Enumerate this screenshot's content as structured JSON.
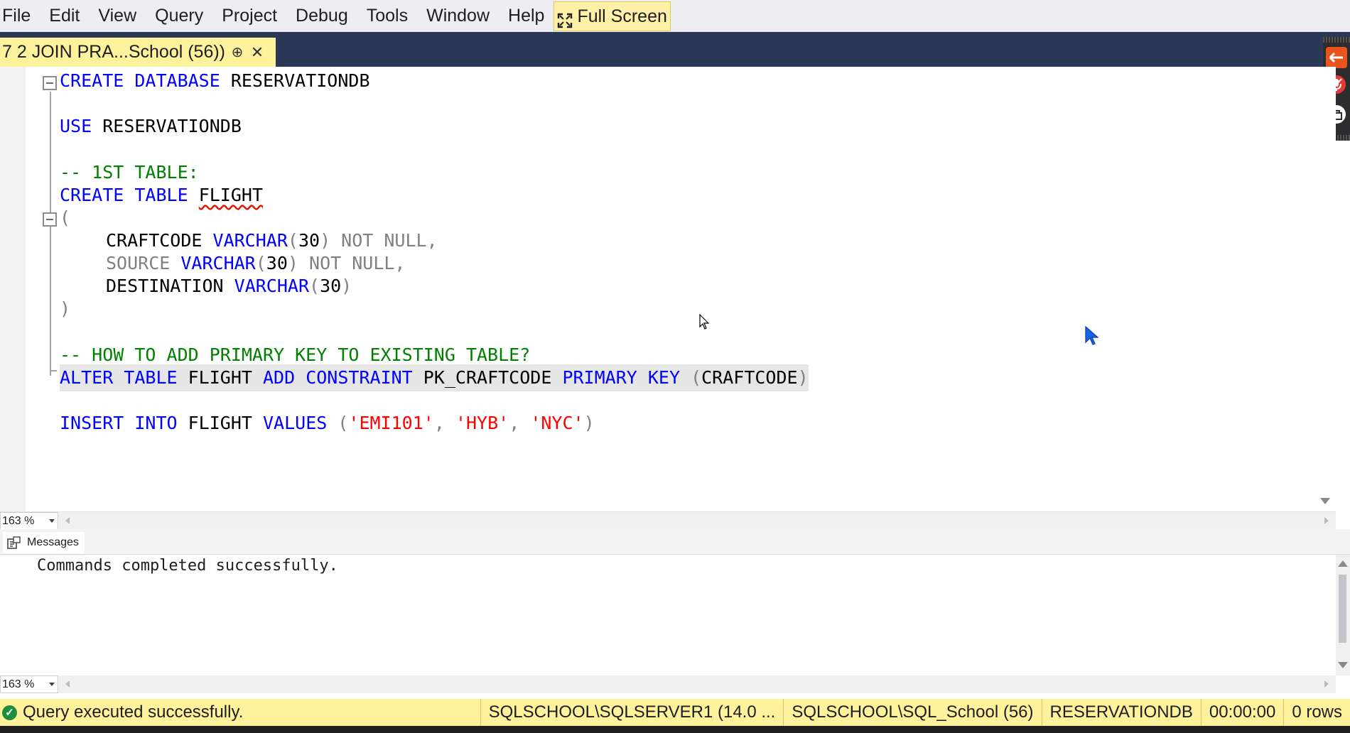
{
  "menu": {
    "items": [
      "File",
      "Edit",
      "View",
      "Query",
      "Project",
      "Debug",
      "Tools",
      "Window",
      "Help"
    ],
    "fullscreen_label": "Full Screen"
  },
  "tab": {
    "title": "7 2 JOIN PRA...School (56))",
    "pin_glyph": "⊕",
    "close_glyph": "✕"
  },
  "editor": {
    "lines": {
      "l1": {
        "kw": "CREATE DATABASE",
        "rest": " RESERVATIONDB"
      },
      "l2": {
        "kw": "USE",
        "rest": " RESERVATIONDB"
      },
      "l3": {
        "comment": "-- 1ST TABLE:"
      },
      "l4": {
        "kw": "CREATE TABLE",
        "name": "FLIGHT"
      },
      "l5": {
        "paren": "("
      },
      "l6": {
        "col": "CRAFTCODE",
        "type": "VARCHAR",
        "open": "(",
        "num": "30",
        "close": ")",
        "tail": " NOT NULL,"
      },
      "l7": {
        "col": "SOURCE",
        "type": "VARCHAR",
        "open": "(",
        "num": "30",
        "close": ")",
        "tail": " NOT NULL,"
      },
      "l8": {
        "col": "DESTINATION",
        "type": "VARCHAR",
        "open": "(",
        "num": "30",
        "close": ")"
      },
      "l9": {
        "paren": ")"
      },
      "l10": {
        "comment": "-- HOW TO ADD PRIMARY KEY TO EXISTING TABLE?"
      },
      "l11": {
        "kw1": "ALTER TABLE",
        "name1": " FLIGHT ",
        "kw2": "ADD CONSTRAINT",
        "name2": " PK_CRAFTCODE ",
        "kw3": "PRIMARY KEY",
        "open": " (",
        "col": "CRAFTCODE",
        "close": ")"
      },
      "l12": {
        "kw": "INSERT INTO",
        "name": " FLIGHT ",
        "kw2": "VALUES",
        "open": " (",
        "v1": "'EMI101'",
        "sep1": ", ",
        "v2": "'HYB'",
        "sep2": ", ",
        "v3": "'NYC'",
        "close": ")"
      }
    },
    "zoom": "163 %"
  },
  "messages": {
    "tab_label": "Messages",
    "text": "Commands completed successfully.",
    "zoom": "163 %"
  },
  "status": {
    "query_status": "Query executed successfully.",
    "server": "SQLSCHOOL\\SQLSERVER1 (14.0 ...",
    "login": "SQLSCHOOL\\SQL_School (56)",
    "database": "RESERVATIONDB",
    "elapsed": "00:00:00",
    "rows": "0 rows"
  },
  "colors": {
    "keyword": "#0000ff",
    "comment": "#008000",
    "string": "#ff0000",
    "status_bar": "#fff29d",
    "tab_strip": "#293955"
  }
}
